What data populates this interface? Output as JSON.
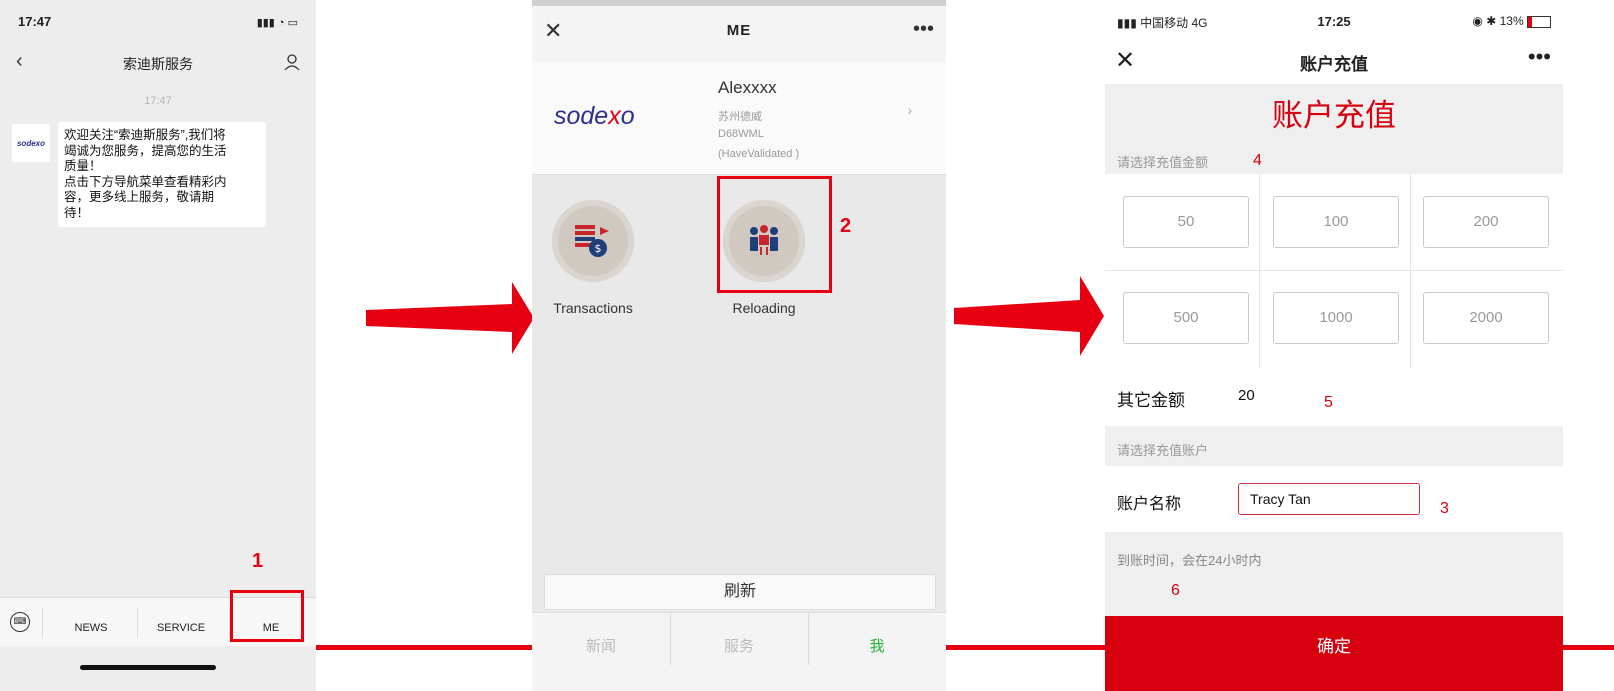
{
  "colors": {
    "accent_red": "#e60012",
    "confirm_red": "#d6000f",
    "wechat_green": "#20b536",
    "brand_blue": "#2b2f8e"
  },
  "phone1": {
    "status_time": "17:47",
    "nav_title": "索迪斯服务",
    "message_time": "17:47",
    "avatar_logo": "sodexo",
    "message_lines": [
      "欢迎关注“索迪斯服务”,我们将",
      "竭诚为您服务，提高您的生活",
      "质量！",
      "点击下方导航菜单查看精彩内",
      "容，更多线上服务，敬请期",
      "待！"
    ],
    "tabs": [
      "NEWS",
      "SERVICE",
      "ME"
    ],
    "step_label": "1"
  },
  "phone2": {
    "title": "ME",
    "logo": "sodexo",
    "user_name": "Alexxxx",
    "user_lines": [
      "苏州德威",
      "D68WML",
      "(HaveValidated )"
    ],
    "menu": [
      {
        "label": "Transactions",
        "icon": "transactions-icon"
      },
      {
        "label": "Reloading",
        "icon": "reloading-icon"
      }
    ],
    "step_label": "2",
    "refresh_label": "刷新",
    "tabs": [
      "新闻",
      "服务",
      "我"
    ]
  },
  "phone3": {
    "carrier": "中国移动 4G",
    "status_time": "17:25",
    "battery": "13%",
    "nav_title": "账户充值",
    "banner_title": "账户充值",
    "amount_hint": "请选择充值金额",
    "amounts": [
      "50",
      "100",
      "200",
      "500",
      "1000",
      "2000"
    ],
    "other_label": "其它金额",
    "other_value": "20",
    "account_hint": "请选择充值账户",
    "account_label": "账户名称",
    "account_value": "Tracy Tan",
    "arrival_note": "到账时间，会在24小时内",
    "confirm_label": "确定",
    "step_labels": {
      "amount": "4",
      "other": "5",
      "account": "3",
      "note": "6"
    }
  }
}
